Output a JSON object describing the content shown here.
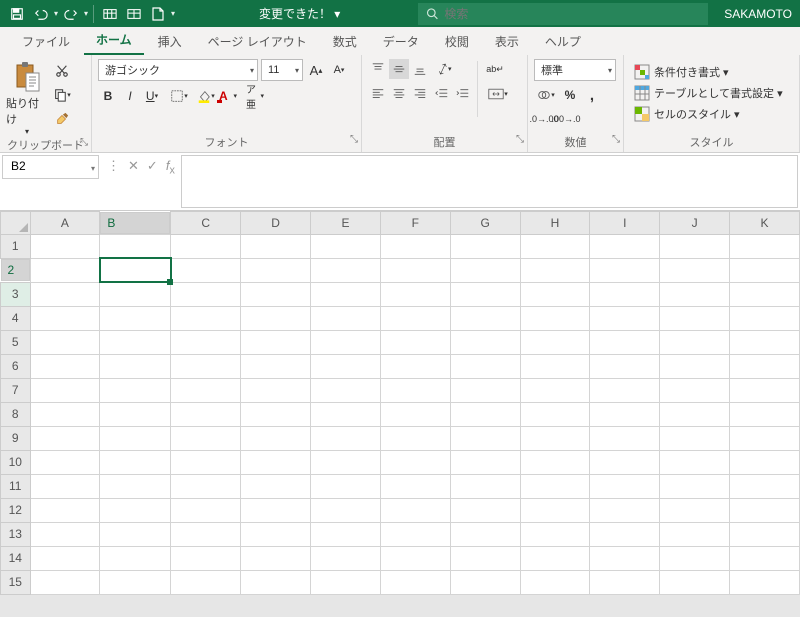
{
  "titlebar": {
    "title": "変更できた！ ▾",
    "search_placeholder": "検索",
    "user": "SAKAMOTO"
  },
  "tabs": [
    "ファイル",
    "ホーム",
    "挿入",
    "ページ レイアウト",
    "数式",
    "データ",
    "校閲",
    "表示",
    "ヘルプ"
  ],
  "active_tab": 1,
  "ribbon": {
    "clipboard": {
      "paste": "貼り付け",
      "label": "クリップボード"
    },
    "font": {
      "name": "游ゴシック",
      "size": "11",
      "label": "フォント"
    },
    "align": {
      "wrap": "ab",
      "merge": "セ",
      "label": "配置"
    },
    "number": {
      "format": "標準",
      "label": "数値"
    },
    "style": {
      "cond": "条件付き書式 ▾",
      "table": "テーブルとして書式設定 ▾",
      "cell": "セルのスタイル ▾",
      "label": "スタイル"
    }
  },
  "fbar": {
    "namebox": "B2"
  },
  "grid": {
    "cols": [
      "A",
      "B",
      "C",
      "D",
      "E",
      "F",
      "G",
      "H",
      "I",
      "J",
      "K"
    ],
    "rows": [
      1,
      2,
      3,
      4,
      5,
      6,
      7,
      8,
      9,
      10,
      11,
      12,
      13,
      14,
      15
    ],
    "selected": {
      "row": 2,
      "col": "B"
    }
  }
}
